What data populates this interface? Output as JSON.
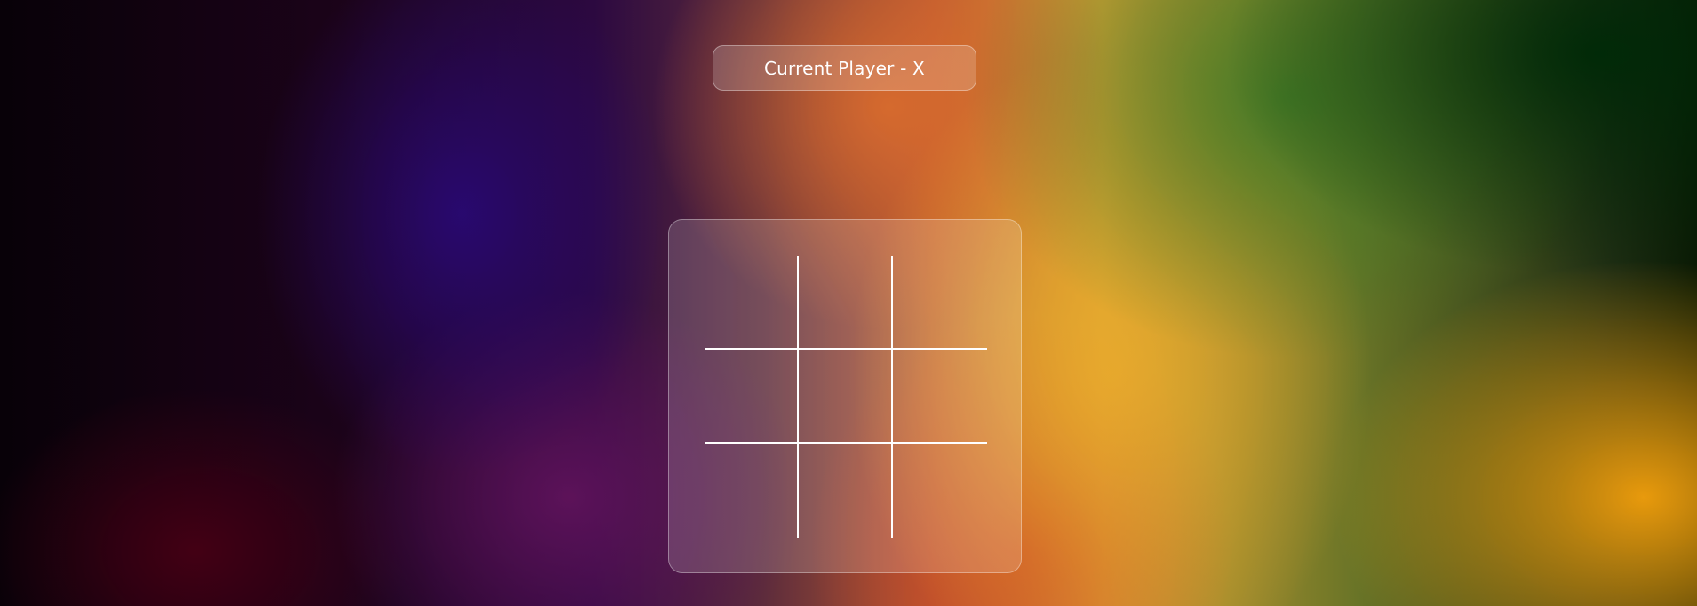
{
  "status": {
    "text": "Current Player - X"
  },
  "board": {
    "cells": [
      "",
      "",
      "",
      "",
      "",
      "",
      "",
      "",
      ""
    ]
  },
  "colors": {
    "line": "#ffffff",
    "text": "#ffffff",
    "panel": "rgba(255,255,255,0.16)"
  }
}
